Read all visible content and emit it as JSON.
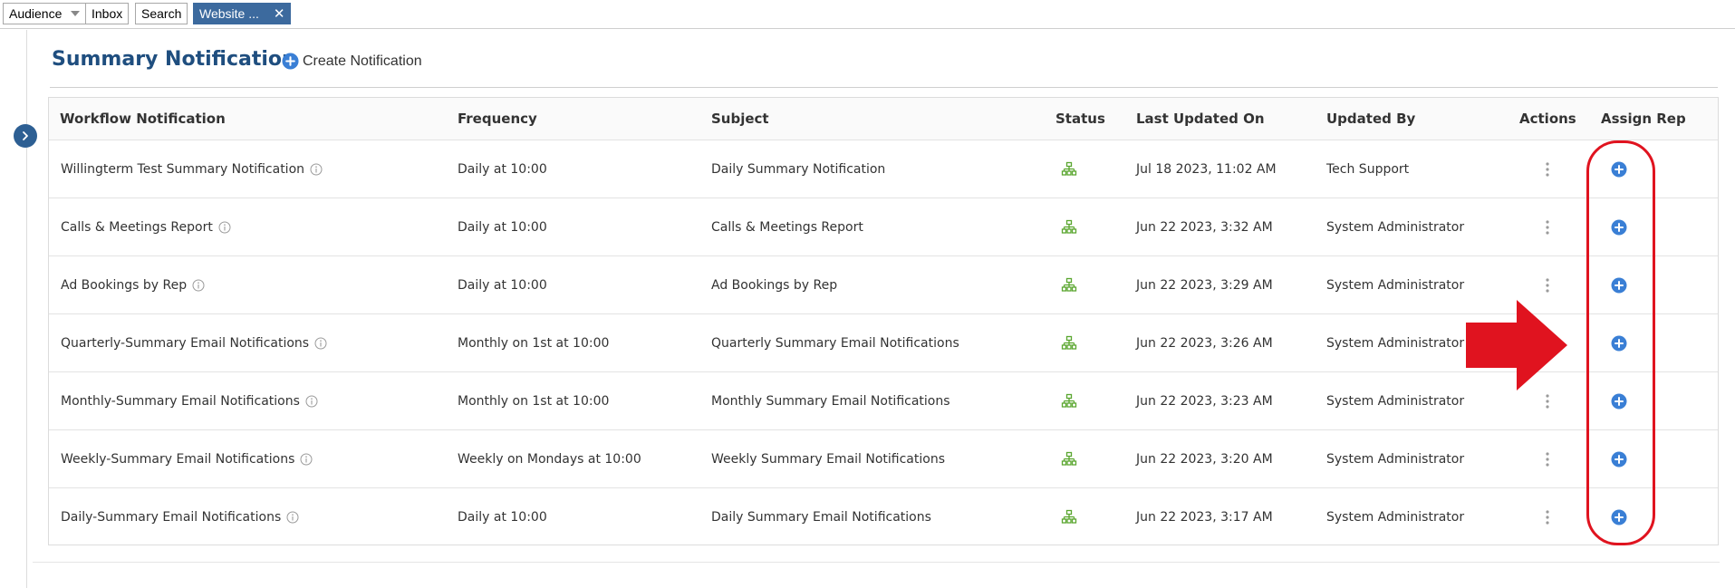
{
  "tabs": [
    {
      "label": "Audience",
      "has_dropdown": true
    },
    {
      "label": "Inbox"
    },
    {
      "label": "Search"
    },
    {
      "label": "Website ...",
      "active": true
    }
  ],
  "header": {
    "title": "Summary Notification",
    "create_label": "Create Notification"
  },
  "table": {
    "columns": [
      "Workflow Notification",
      "Frequency",
      "Subject",
      "Status",
      "Last Updated On",
      "Updated By",
      "Actions",
      "Assign Rep"
    ],
    "rows": [
      {
        "name": "Willingterm Test Summary Notification",
        "frequency": "Daily at 10:00",
        "subject": "Daily Summary Notification",
        "updated_on": "Jul 18 2023, 11:02 AM",
        "updated_by": "Tech Support"
      },
      {
        "name": "Calls & Meetings Report",
        "frequency": "Daily at 10:00",
        "subject": "Calls & Meetings Report",
        "updated_on": "Jun 22 2023, 3:32 AM",
        "updated_by": "System Administrator"
      },
      {
        "name": "Ad Bookings by Rep",
        "frequency": "Daily at 10:00",
        "subject": "Ad Bookings by Rep",
        "updated_on": "Jun 22 2023, 3:29 AM",
        "updated_by": "System Administrator"
      },
      {
        "name": "Quarterly-Summary Email Notifications",
        "frequency": "Monthly on 1st at 10:00",
        "subject": "Quarterly Summary Email Notifications",
        "updated_on": "Jun 22 2023, 3:26 AM",
        "updated_by": "System Administrator"
      },
      {
        "name": "Monthly-Summary Email Notifications",
        "frequency": "Monthly on 1st at 10:00",
        "subject": "Monthly Summary Email Notifications",
        "updated_on": "Jun 22 2023, 3:23 AM",
        "updated_by": "System Administrator"
      },
      {
        "name": "Weekly-Summary Email Notifications",
        "frequency": "Weekly on Mondays at 10:00",
        "subject": "Weekly Summary Email Notifications",
        "updated_on": "Jun 22 2023, 3:20 AM",
        "updated_by": "System Administrator"
      },
      {
        "name": "Daily-Summary Email Notifications",
        "frequency": "Daily at 10:00",
        "subject": "Daily Summary Email Notifications",
        "updated_on": "Jun 22 2023, 3:17 AM",
        "updated_by": "System Administrator"
      }
    ]
  },
  "icons": {
    "info": "info-circle-icon",
    "status": "workflow-hierarchy-icon",
    "actions": "kebab-menu-icon",
    "assign": "plus-circle-icon",
    "expand": "chevron-right-icon"
  },
  "colors": {
    "title": "#1f4e7f",
    "active_tab": "#3c6a9e",
    "status_green": "#5aa62f",
    "assign_blue": "#3a7fd5",
    "annotation_red": "#e0131f"
  }
}
